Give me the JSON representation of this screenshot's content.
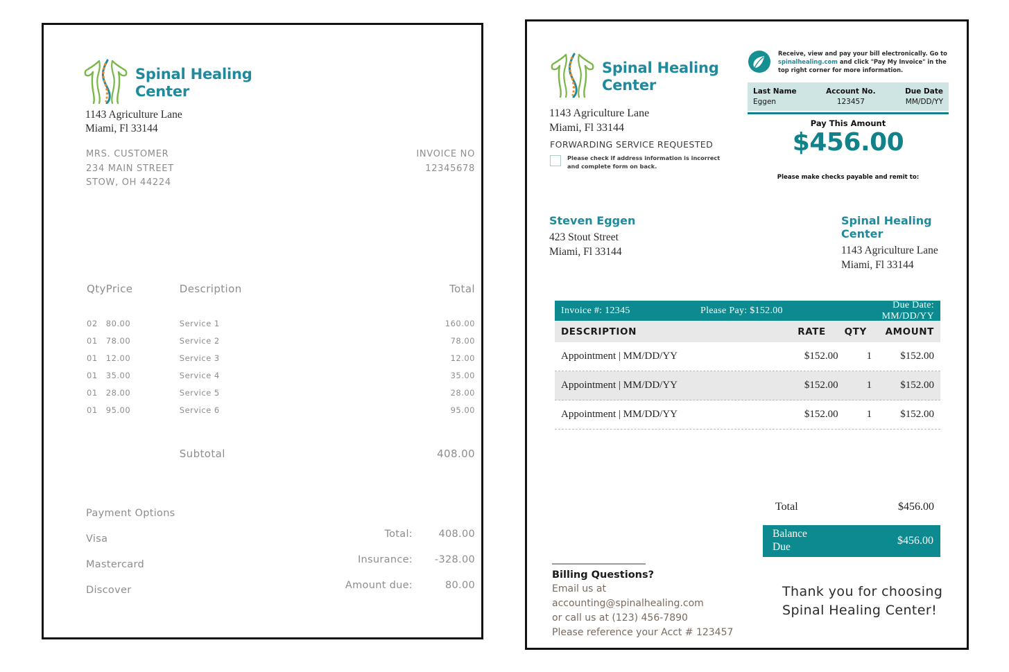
{
  "brand": {
    "name_line1": "Spinal Healing",
    "name_line2": "Center",
    "logo_icon": "spine-torso-logo",
    "accent_teal": "#0d8a8f",
    "accent_logo_teal": "#1f8a9c",
    "band_mint": "#cfe5e3",
    "logo_green": "#7ab648",
    "logo_orange": "#ef8b22"
  },
  "left_invoice": {
    "company_address": [
      "1143 Agriculture Lane",
      "Miami, Fl 33144"
    ],
    "customer": [
      "MRS. CUSTOMER",
      "234 MAIN STREET",
      "STOW, OH 44224"
    ],
    "invoice_no_label": "INVOICE NO",
    "invoice_no_value": "12345678",
    "table": {
      "headers": [
        "Qty",
        "Price",
        "Description",
        "Total"
      ],
      "rows": [
        {
          "qty": "02",
          "price": "80.00",
          "description": "Service 1",
          "total": "160.00"
        },
        {
          "qty": "01",
          "price": "78.00",
          "description": "Service 2",
          "total": "78.00"
        },
        {
          "qty": "01",
          "price": "12.00",
          "description": "Service 3",
          "total": "12.00"
        },
        {
          "qty": "01",
          "price": "35.00",
          "description": "Service 4",
          "total": "35.00"
        },
        {
          "qty": "01",
          "price": "28.00",
          "description": "Service 5",
          "total": "28.00"
        },
        {
          "qty": "01",
          "price": "95.00",
          "description": "Service 6",
          "total": "95.00"
        }
      ],
      "subtotal_label": "Subtotal",
      "subtotal_value": "408.00"
    },
    "payment_options_title": "Payment Options",
    "payment_options": [
      "Visa",
      "Mastercard",
      "Discover"
    ],
    "totals": [
      {
        "label": "Total:",
        "value": "408.00"
      },
      {
        "label": "Insurance:",
        "value": "-328.00"
      },
      {
        "label": "Amount due:",
        "value": "80.00"
      }
    ]
  },
  "right_statement": {
    "company_address": [
      "1143 Agriculture Lane",
      "Miami, Fl 33144"
    ],
    "forwarding_notice": "FORWARDING SERVICE REQUESTED",
    "address_checkbox": {
      "icon": "empty-checkbox-icon",
      "line1": "Please check if address information is incorrect",
      "line2": "and complete form on back."
    },
    "notice": {
      "icon": "leaf-circle-icon",
      "text_before_link": "Receive, view and pay your bill electronically. Go to ",
      "link": "spinalhealing.com",
      "text_after_link": " and click \"Pay My Invoice\" in the top right corner for more information."
    },
    "account_band": [
      {
        "key": "Last Name",
        "value": "Eggen"
      },
      {
        "key": "Account No.",
        "value": "123457"
      },
      {
        "key": "Due Date",
        "value": "MM/DD/YY"
      }
    ],
    "pay_this_amount_label": "Pay This Amount",
    "pay_this_amount_value": "$456.00",
    "remit_note": "Please make checks payable and remit to:",
    "payer": {
      "name": "Steven Eggen",
      "lines": [
        "423 Stout Street",
        "Miami, Fl 33144"
      ]
    },
    "payee": {
      "name": "Spinal Healing Center",
      "lines": [
        "1143 Agriculture Lane",
        "Miami, Fl 33144"
      ]
    },
    "invoice_bar": {
      "invoice_no": "Invoice #: 12345",
      "please_pay": "Please Pay:  $152.00",
      "due_date": "Due Date:  MM/DD/YY"
    },
    "table": {
      "headers": {
        "description": "DESCRIPTION",
        "rate": "RATE",
        "qty": "QTY",
        "amount": "AMOUNT"
      },
      "rows": [
        {
          "description": "Appointment | MM/DD/YY",
          "rate": "$152.00",
          "qty": "1",
          "amount": "$152.00"
        },
        {
          "description": "Appointment | MM/DD/YY",
          "rate": "$152.00",
          "qty": "1",
          "amount": "$152.00"
        },
        {
          "description": "Appointment | MM/DD/YY",
          "rate": "$152.00",
          "qty": "1",
          "amount": "$152.00"
        }
      ]
    },
    "total_label": "Total",
    "total_value": "$456.00",
    "balance_due_line1": "Balance",
    "balance_due_line2": "Due",
    "balance_due_value": "$456.00",
    "footer": {
      "heading": "Billing Questions?",
      "line1": "Email us at",
      "line2": "accounting@spinalhealing.com",
      "line3": "or call us at (123) 456-7890",
      "line4": "Please reference your Acct # 123457"
    },
    "thank_you": "Thank you for choosing Spinal Healing Center!"
  }
}
